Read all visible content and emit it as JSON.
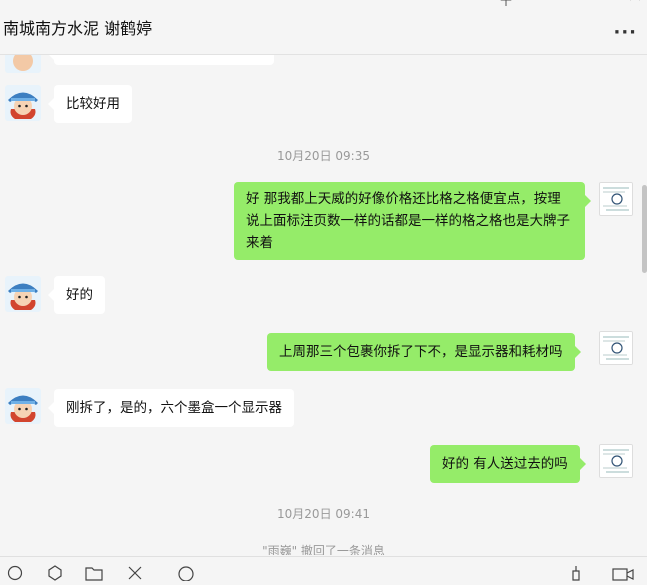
{
  "window": {
    "title": "南城南方水泥 谢鹤婷",
    "more_label": "···",
    "pin_icon": "pin-icon",
    "minimize_icon": "minimize-icon",
    "maximize_icon": "maximize-icon",
    "close_icon": "close-icon"
  },
  "messages": [
    {
      "side": "left",
      "text": "比较好用"
    },
    {
      "type": "time",
      "text": "10月20日 09:35"
    },
    {
      "side": "right",
      "text": "好 那我都上天威的好像价格还比格之格便宜点，按理说上面标注页数一样的话都是一样的格之格也是大牌子来着"
    },
    {
      "side": "left",
      "text": "好的"
    },
    {
      "side": "right",
      "text": "上周那三个包裹你拆了下不，是显示器和耗材吗"
    },
    {
      "side": "left",
      "text": "刚拆了，是的，六个墨盒一个显示器"
    },
    {
      "side": "right",
      "text": "好的 有人送过去的吗"
    },
    {
      "type": "time",
      "text": "10月20日 09:41"
    },
    {
      "type": "recall",
      "text": "\"雨巍\" 撤回了一条消息"
    }
  ],
  "toolbar": {
    "icons": [
      "emoji-icon",
      "favorites-icon",
      "folder-icon",
      "scissors-icon",
      "chat-history-icon",
      "voice-call-icon",
      "video-call-icon"
    ]
  },
  "colors": {
    "bubble_self": "#95ec69",
    "bubble_other": "#ffffff",
    "background": "#f5f5f5"
  }
}
